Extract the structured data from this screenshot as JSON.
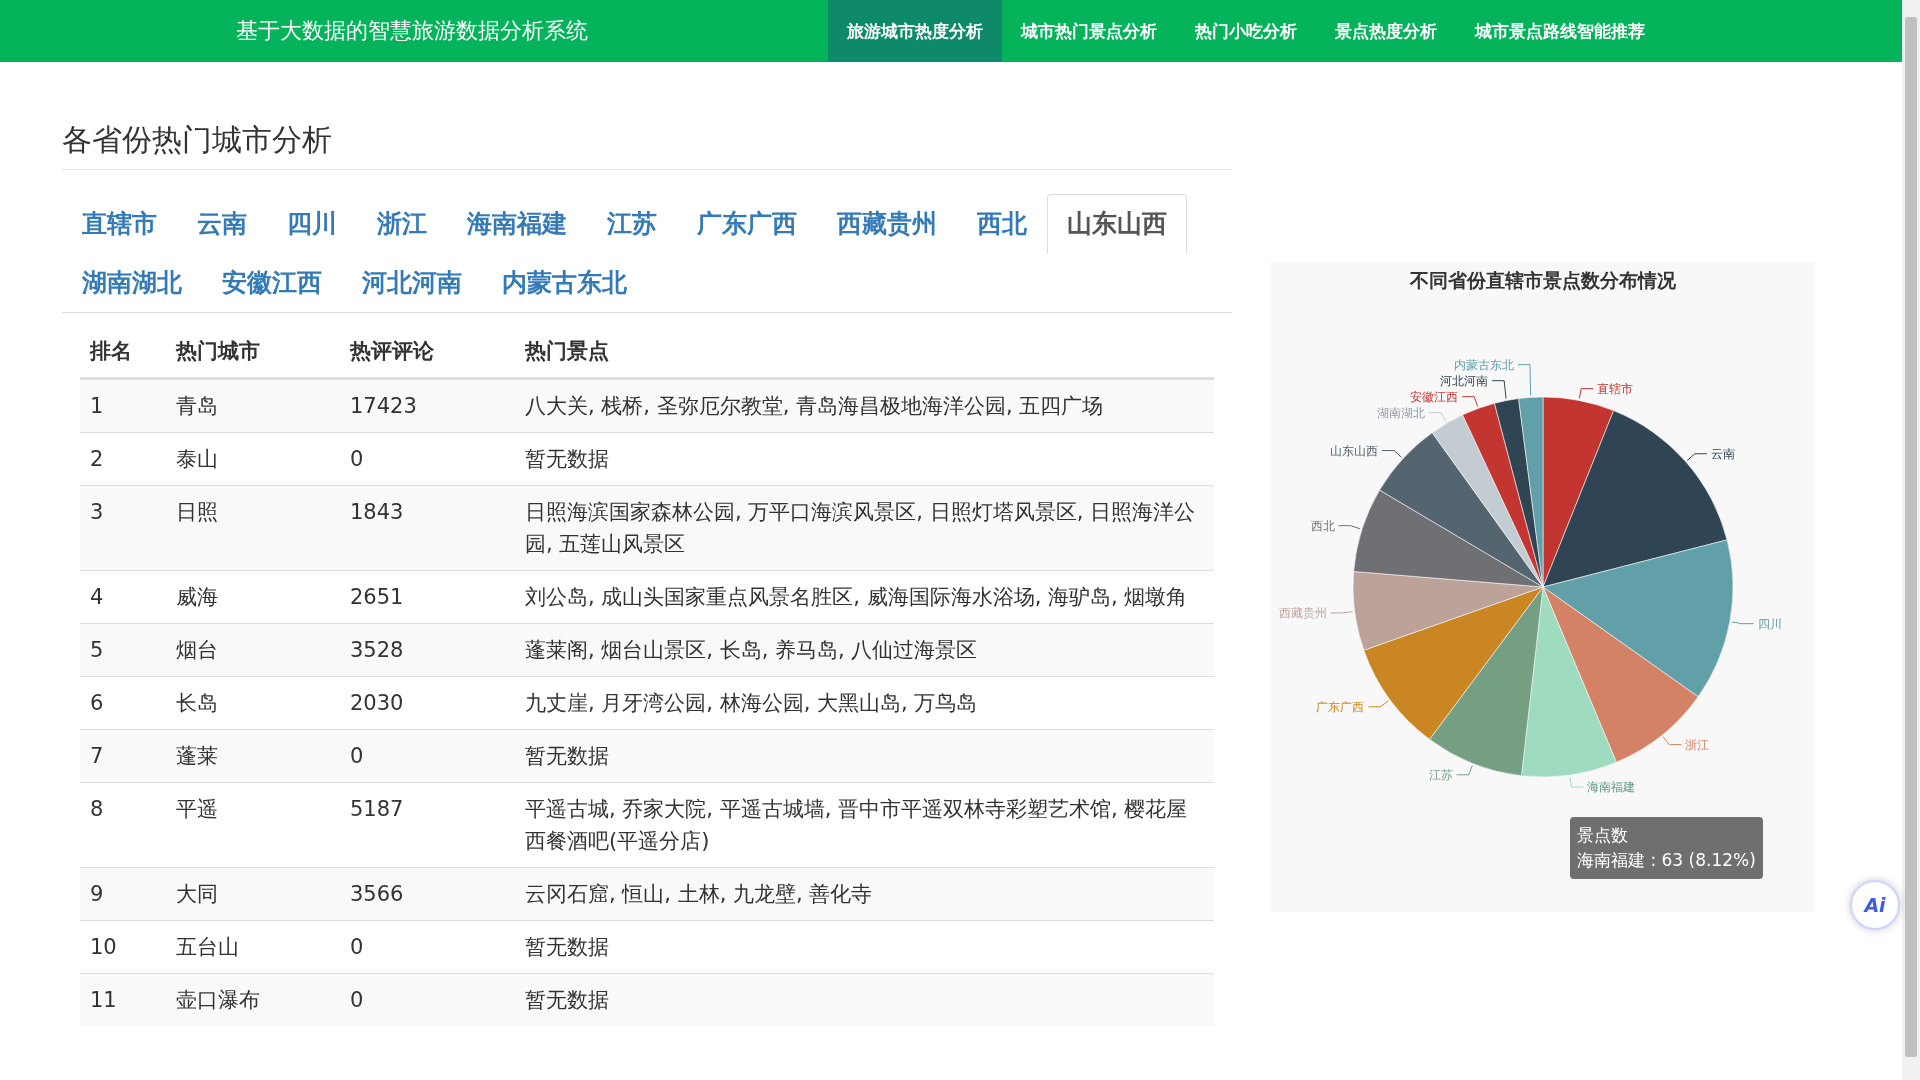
{
  "header": {
    "title": "基于大数据的智慧旅游数据分析系统",
    "nav": [
      {
        "label": "旅游城市热度分析",
        "selected": true
      },
      {
        "label": "城市热门景点分析",
        "selected": false
      },
      {
        "label": "热门小吃分析",
        "selected": false
      },
      {
        "label": "景点热度分析",
        "selected": false
      },
      {
        "label": "城市景点路线智能推荐",
        "selected": false
      }
    ]
  },
  "section_title": "各省份热门城市分析",
  "tabs": [
    {
      "label": "直辖市",
      "selected": false
    },
    {
      "label": "云南",
      "selected": false
    },
    {
      "label": "四川",
      "selected": false
    },
    {
      "label": "浙江",
      "selected": false
    },
    {
      "label": "海南福建",
      "selected": false
    },
    {
      "label": "江苏",
      "selected": false
    },
    {
      "label": "广东广西",
      "selected": false
    },
    {
      "label": "西藏贵州",
      "selected": false
    },
    {
      "label": "西北",
      "selected": false
    },
    {
      "label": "山东山西",
      "selected": true
    },
    {
      "label": "湖南湖北",
      "selected": false
    },
    {
      "label": "安徽江西",
      "selected": false
    },
    {
      "label": "河北河南",
      "selected": false
    },
    {
      "label": "内蒙古东北",
      "selected": false
    }
  ],
  "table": {
    "columns": [
      "排名",
      "热门城市",
      "热评评论",
      "热门景点"
    ],
    "rows": [
      [
        "1",
        "青岛",
        "17423",
        "八大关, 栈桥, 圣弥厄尔教堂, 青岛海昌极地海洋公园, 五四广场"
      ],
      [
        "2",
        "泰山",
        "0",
        "暂无数据"
      ],
      [
        "3",
        "日照",
        "1843",
        "日照海滨国家森林公园, 万平口海滨风景区, 日照灯塔风景区, 日照海洋公园, 五莲山风景区"
      ],
      [
        "4",
        "威海",
        "2651",
        "刘公岛, 成山头国家重点风景名胜区, 威海国际海水浴场, 海驴岛, 烟墩角"
      ],
      [
        "5",
        "烟台",
        "3528",
        "蓬莱阁, 烟台山景区, 长岛, 养马岛, 八仙过海景区"
      ],
      [
        "6",
        "长岛",
        "2030",
        "九丈崖, 月牙湾公园, 林海公园, 大黑山岛, 万鸟岛"
      ],
      [
        "7",
        "蓬莱",
        "0",
        "暂无数据"
      ],
      [
        "8",
        "平遥",
        "5187",
        "平遥古城, 乔家大院, 平遥古城墙, 晋中市平遥双林寺彩塑艺术馆, 樱花屋西餐酒吧(平遥分店)"
      ],
      [
        "9",
        "大同",
        "3566",
        "云冈石窟, 恒山, 土林, 九龙壁, 善化寺"
      ],
      [
        "10",
        "五台山",
        "0",
        "暂无数据"
      ],
      [
        "11",
        "壶口瀑布",
        "0",
        "暂无数据"
      ]
    ]
  },
  "chart": {
    "chart_data": {
      "type": "pie",
      "title": "不同省份直辖市景点数分布情况",
      "categories": [
        "直辖市",
        "云南",
        "四川",
        "浙江",
        "海南福建",
        "江苏",
        "广东广西",
        "西藏贵州",
        "西北",
        "山东山西",
        "湖南湖北",
        "安徽江西",
        "河北河南",
        "内蒙古东北"
      ],
      "series": [
        {
          "name": "景点数",
          "colors": [
            "#c23531",
            "#2f4554",
            "#61a0a8",
            "#d48265",
            "#9fdbbf",
            "#749f83",
            "#ca8622",
            "#bda29a",
            "#6e7074",
            "#546570",
            "#c4ccd3",
            "#c23531",
            "#2f4554",
            "#61a0a8"
          ],
          "values": [
            6.06,
            14.95,
            13.79,
            8.89,
            8.12,
            8.38,
            9.41,
            6.7,
            7.22,
            6.57,
            2.96,
            2.84,
            2.06,
            2.05
          ]
        }
      ]
    },
    "tooltip": {
      "text": "海南福建 : 63 (8.12%)"
    }
  },
  "ai_button": {
    "label": "Ai"
  }
}
